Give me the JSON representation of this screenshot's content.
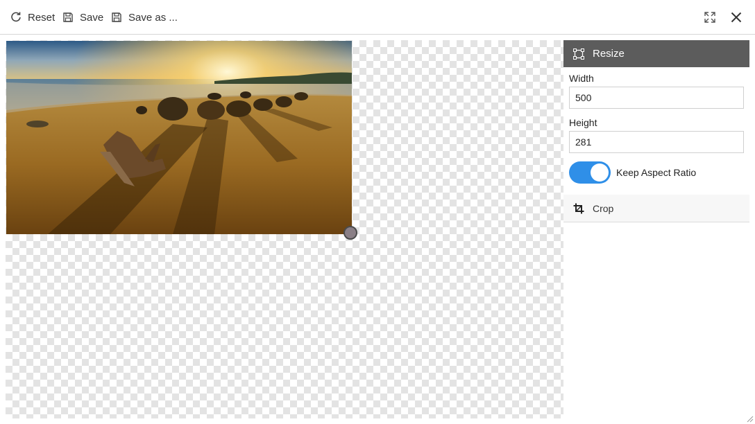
{
  "toolbar": {
    "reset_label": "Reset",
    "save_label": "Save",
    "save_as_label": "Save as ...",
    "icons": [
      "refresh-icon",
      "floppy-disk-icon",
      "floppy-disk-icon",
      "expand-icon",
      "close-icon"
    ]
  },
  "canvas": {
    "image_description_icon": "beach-sunset-photo",
    "background_pattern": "transparency-checkerboard"
  },
  "panel": {
    "resize_label": "Resize",
    "width_label": "Width",
    "width_value": "500",
    "height_label": "Height",
    "height_value": "281",
    "keep_aspect_label": "Keep Aspect Ratio",
    "keep_aspect_on": true,
    "crop_label": "Crop",
    "icons": [
      "resize-frame-icon",
      "crop-icon"
    ]
  },
  "colors": {
    "panel_header_bg": "#5c5c5c",
    "toggle_on": "#2f8fe8",
    "handle": "#8a7f86"
  }
}
